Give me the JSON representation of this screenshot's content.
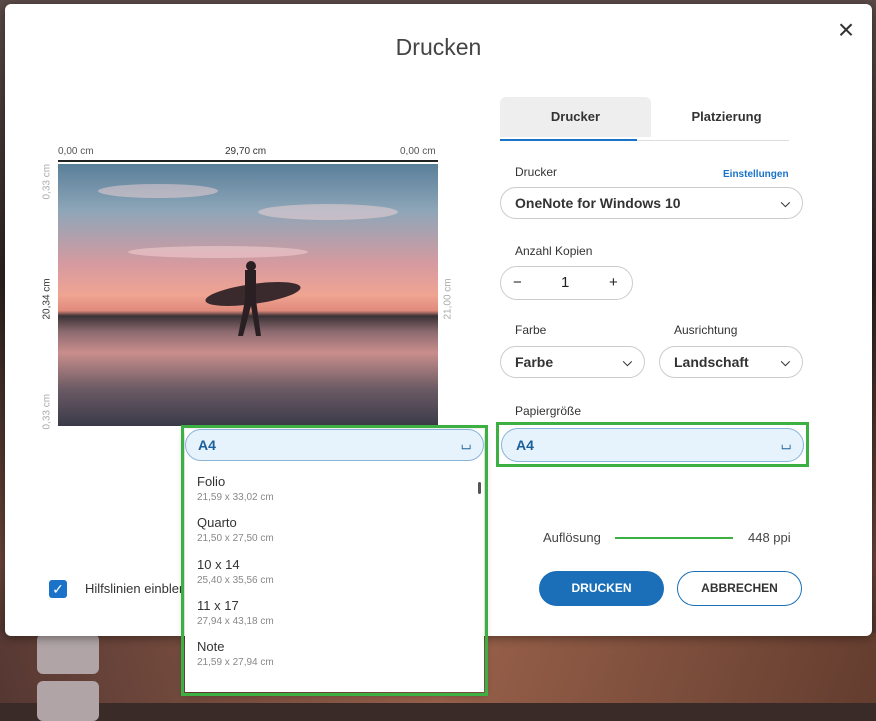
{
  "dialog": {
    "title": "Drucken",
    "close_icon": "×"
  },
  "preview": {
    "ruler_top": [
      "0,00 cm",
      "29,70 cm",
      "0,00 cm"
    ],
    "ruler_left": [
      "0,33 cm",
      "20,34 cm",
      "0,33 cm"
    ],
    "ruler_right": "21,00 cm",
    "guides_label": "Hilfslinien einbler",
    "guides_checked": true
  },
  "tabs": [
    {
      "label": "Drucker",
      "active": true
    },
    {
      "label": "Platzierung",
      "active": false
    }
  ],
  "printer": {
    "label": "Drucker",
    "settings_link": "Einstellungen",
    "value": "OneNote for Windows 10"
  },
  "copies": {
    "label": "Anzahl Kopien",
    "value": "1",
    "minus": "−",
    "plus": "+"
  },
  "color": {
    "label": "Farbe",
    "value": "Farbe"
  },
  "orientation": {
    "label": "Ausrichtung",
    "value": "Landschaft"
  },
  "paper": {
    "label": "Papiergröße",
    "value": "A4"
  },
  "resolution": {
    "label": "Auflösung",
    "value": "448 ppi"
  },
  "buttons": {
    "print": "DRUCKEN",
    "cancel": "ABBRECHEN"
  },
  "dropdown": {
    "selected": "A4",
    "options": [
      {
        "name": "Folio",
        "size": "21,59 x 33,02 cm"
      },
      {
        "name": "Quarto",
        "size": "21,50 x 27,50 cm"
      },
      {
        "name": "10 x 14",
        "size": "25,40 x 35,56 cm"
      },
      {
        "name": "11 x 17",
        "size": "27,94 x 43,18 cm"
      },
      {
        "name": "Note",
        "size": "21,59 x 27,94 cm"
      }
    ]
  },
  "colors": {
    "accent": "#1a73c8",
    "highlight": "#3cb043"
  },
  "icons": {
    "chevron_down": "chevron-down-icon",
    "chevron_up": "chevron-up-icon",
    "check": "check-icon",
    "close": "close-icon"
  }
}
